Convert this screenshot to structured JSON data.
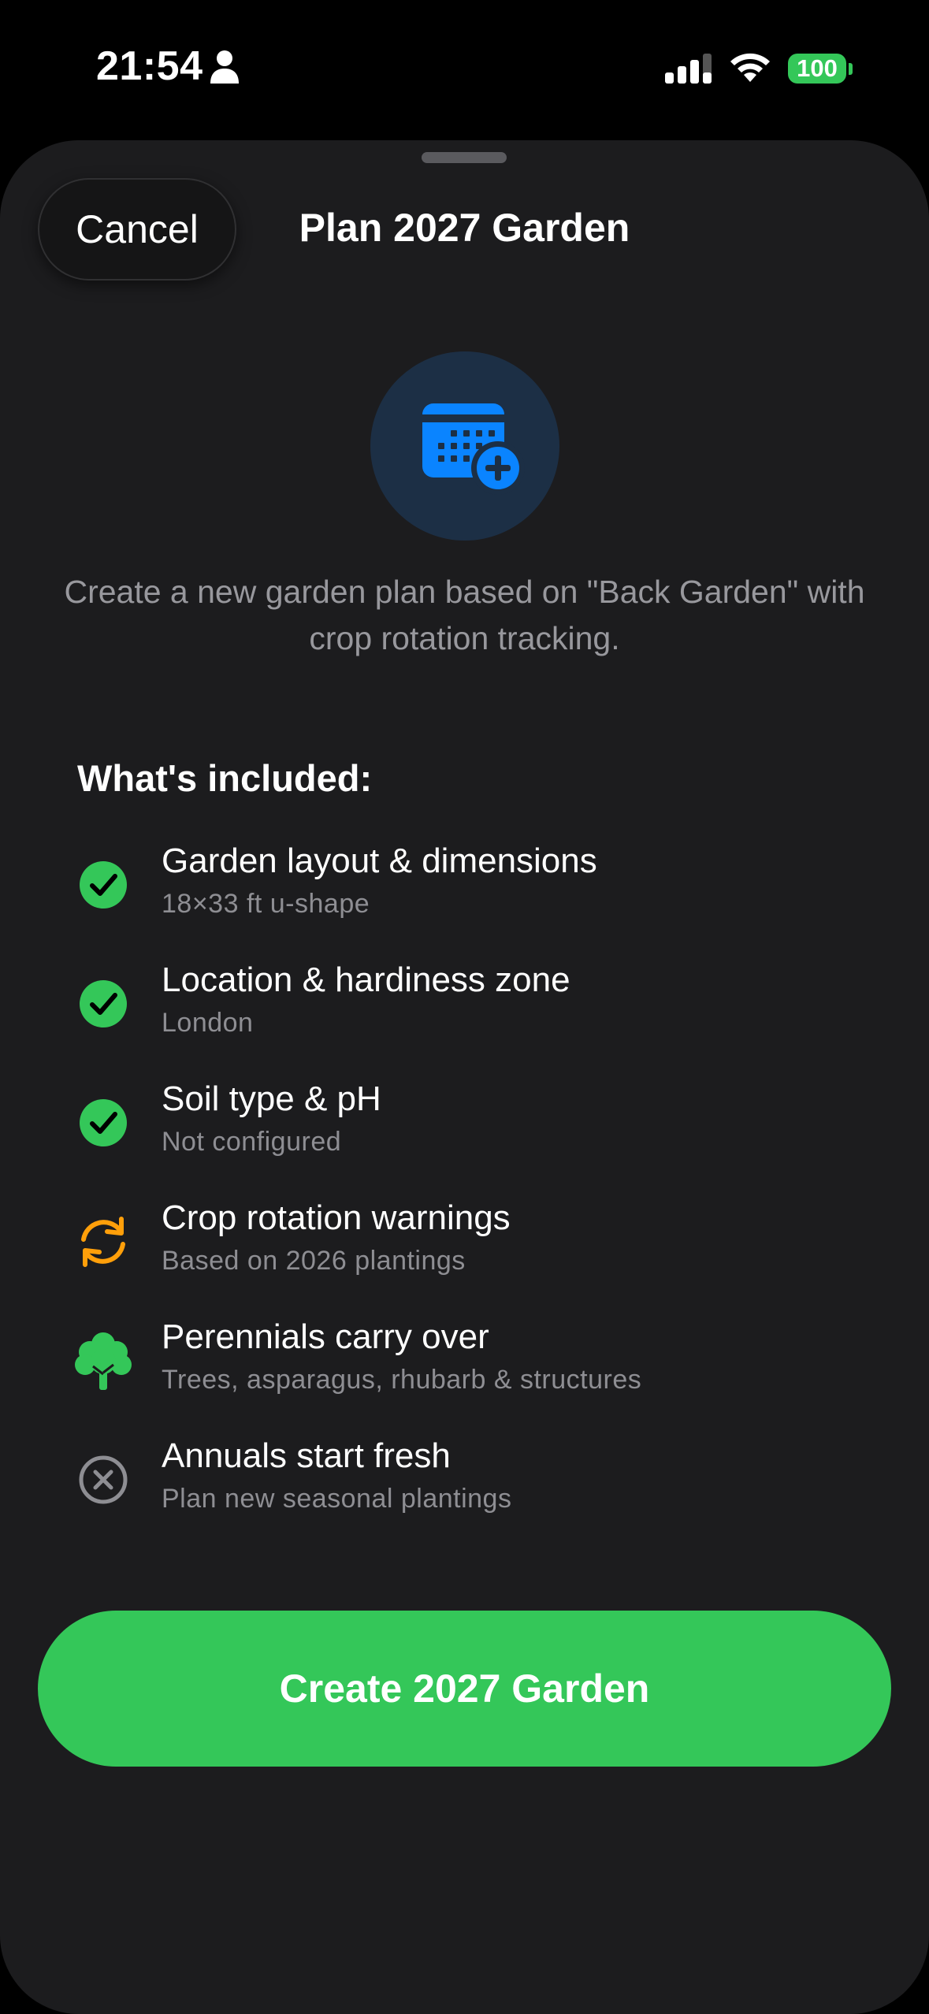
{
  "status_bar": {
    "time": "21:54",
    "battery": "100"
  },
  "sheet": {
    "cancel_label": "Cancel",
    "title": "Plan 2027 Garden",
    "hero_icon": "calendar-plus-icon",
    "description": "Create a new garden plan based on \"Back Garden\" with crop rotation tracking.",
    "section_heading": "What's included:",
    "items": [
      {
        "title": "Garden layout & dimensions",
        "subtitle": "18×33 ft u-shape",
        "icon": "checkmark-circle-icon",
        "color": "#34c759"
      },
      {
        "title": "Location & hardiness zone",
        "subtitle": "London",
        "icon": "checkmark-circle-icon",
        "color": "#34c759"
      },
      {
        "title": "Soil type & pH",
        "subtitle": "Not configured",
        "icon": "checkmark-circle-icon",
        "color": "#34c759"
      },
      {
        "title": "Crop rotation warnings",
        "subtitle": "Based on 2026 plantings",
        "icon": "rotation-arrows-icon",
        "color": "#ff9f0a"
      },
      {
        "title": "Perennials carry over",
        "subtitle": "Trees, asparagus, rhubarb & structures",
        "icon": "tree-icon",
        "color": "#34c759"
      },
      {
        "title": "Annuals start fresh",
        "subtitle": "Plan new seasonal plantings",
        "icon": "xmark-circle-icon",
        "color": "#8e8e93"
      }
    ],
    "create_label": "Create 2027 Garden"
  },
  "colors": {
    "accent_green": "#34c759",
    "accent_blue": "#0a84ff",
    "warning_orange": "#ff9f0a",
    "sheet_background": "#1c1c1e"
  }
}
